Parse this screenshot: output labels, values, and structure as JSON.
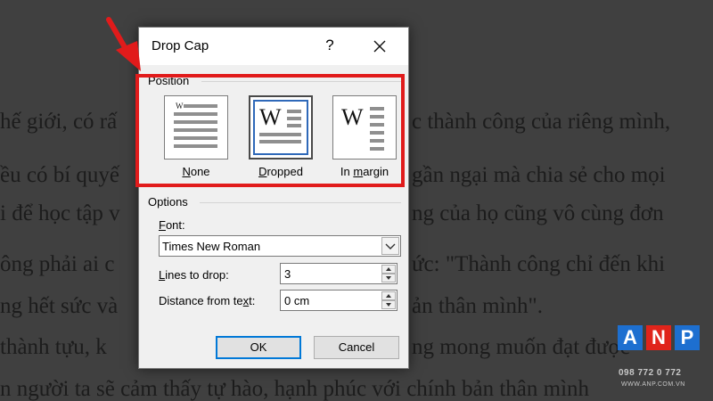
{
  "document": {
    "lines": [
      "hế giới, có rấ",
      "c thành công của riêng mình,",
      "ều có bí quyế",
      "gần ngại mà chia sẻ cho mọi",
      "i để học tập v",
      "ng của họ cũng vô cùng đơn",
      "ông phải ai c",
      "ức: \"Thành công chỉ đến khi",
      "ng hết sức và",
      "ản thân mình\".",
      "thành tựu, k",
      "ng mong muốn đạt được",
      "n người ta sẽ cảm thấy tự hào, hạnh phúc với chính bản thân mình"
    ]
  },
  "dialog": {
    "title": "Drop Cap",
    "help_label": "?",
    "position": {
      "group_label": "Position",
      "options": [
        {
          "mnemonic": "N",
          "rest": "one",
          "selected": false
        },
        {
          "mnemonic": "D",
          "rest": "ropped",
          "selected": true
        },
        {
          "pre": "In ",
          "mnemonic": "m",
          "rest": "argin",
          "selected": false
        }
      ],
      "preview_letter": "W"
    },
    "options": {
      "group_label": "Options",
      "font": {
        "label_mnemonic": "F",
        "label_rest": "ont:",
        "value": "Times New Roman"
      },
      "lines_to_drop": {
        "label_mnemonic": "L",
        "label_rest": "ines to drop:",
        "value": "3"
      },
      "distance": {
        "label_pre": "Distance from te",
        "label_mnemonic": "x",
        "label_rest": "t:",
        "value": "0 cm"
      }
    },
    "buttons": {
      "ok": "OK",
      "cancel": "Cancel"
    }
  },
  "watermark": {
    "letters": [
      "A",
      "N",
      "P"
    ],
    "phone": "098 772 0 772",
    "website": "WWW.ANP.COM.VN"
  },
  "colors": {
    "highlight": "#e11b1b",
    "selection": "#2f69b9",
    "anp_red": "#e0241b",
    "anp_blue": "#1d6fd0"
  }
}
